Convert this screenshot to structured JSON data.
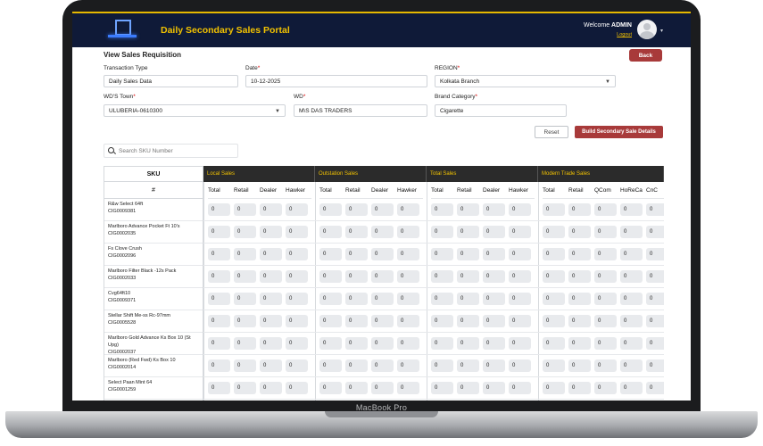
{
  "device": {
    "label": "MacBook Pro"
  },
  "header": {
    "title": "Daily Secondary Sales Portal",
    "welcome_prefix": "Welcome",
    "user": "ADMIN",
    "logout": "Logout"
  },
  "page": {
    "title": "View Sales Requisition",
    "back_label": "Back"
  },
  "form": {
    "transaction_type": {
      "label": "Transaction Type",
      "value": "Daily Sales Data"
    },
    "date": {
      "label": "Date",
      "required": "*",
      "value": "10-12-2025"
    },
    "region": {
      "label": "REGION",
      "required": "*",
      "value": "Kolkata Branch"
    },
    "wd_town": {
      "label": "WD'S Town",
      "required": "*",
      "value": "ULUBERIA-0610300"
    },
    "wd": {
      "label": "WD",
      "required": "*",
      "value": "M\\S DAS TRADERS"
    },
    "brand_category": {
      "label": "Brand Category",
      "required": "*",
      "value": "Cigarette"
    }
  },
  "actions": {
    "reset_label": "Reset",
    "build_label": "Build Secondary Sale Details"
  },
  "search": {
    "placeholder": "Search SKU Number"
  },
  "table": {
    "sku_header": "SKU",
    "hash_header": "#",
    "groups": [
      {
        "name": "Local Sales",
        "columns": [
          "Total",
          "Retail",
          "Dealer",
          "Hawker"
        ]
      },
      {
        "name": "Outstation Sales",
        "columns": [
          "Total",
          "Retail",
          "Dealer",
          "Hawker"
        ]
      },
      {
        "name": "Total Sales",
        "columns": [
          "Total",
          "Retail",
          "Dealer",
          "Hawker"
        ]
      },
      {
        "name": "Modern Trade Sales",
        "columns": [
          "Total",
          "Retail",
          "QCom",
          "HoReCa",
          "CnC"
        ]
      }
    ],
    "rows": [
      {
        "name": "R&w Select 64ft",
        "code": "CIG0009381"
      },
      {
        "name": "Marlboro Advance Pocket Ft 10's",
        "code": "CIG0002035"
      },
      {
        "name": "Fs Clove Crush",
        "code": "CIG0002096"
      },
      {
        "name": "Marlboro Filter Black -12s Pack",
        "code": "CIG0002033"
      },
      {
        "name": "Cvg64ft10",
        "code": "CIG0009371"
      },
      {
        "name": "Stellar Shift Me-ss Rc-97mm",
        "code": "CIG0005528"
      },
      {
        "name": "Marlboro Gold Advance Ks Box 10 (St Upg)",
        "code": "CIG0002037"
      },
      {
        "name": "Marlboro (Red Fwd) Ks Box 10",
        "code": "CIG0002014"
      },
      {
        "name": "Select Paan Mint 64",
        "code": "CIG0001259"
      }
    ],
    "cell_value": "0"
  }
}
